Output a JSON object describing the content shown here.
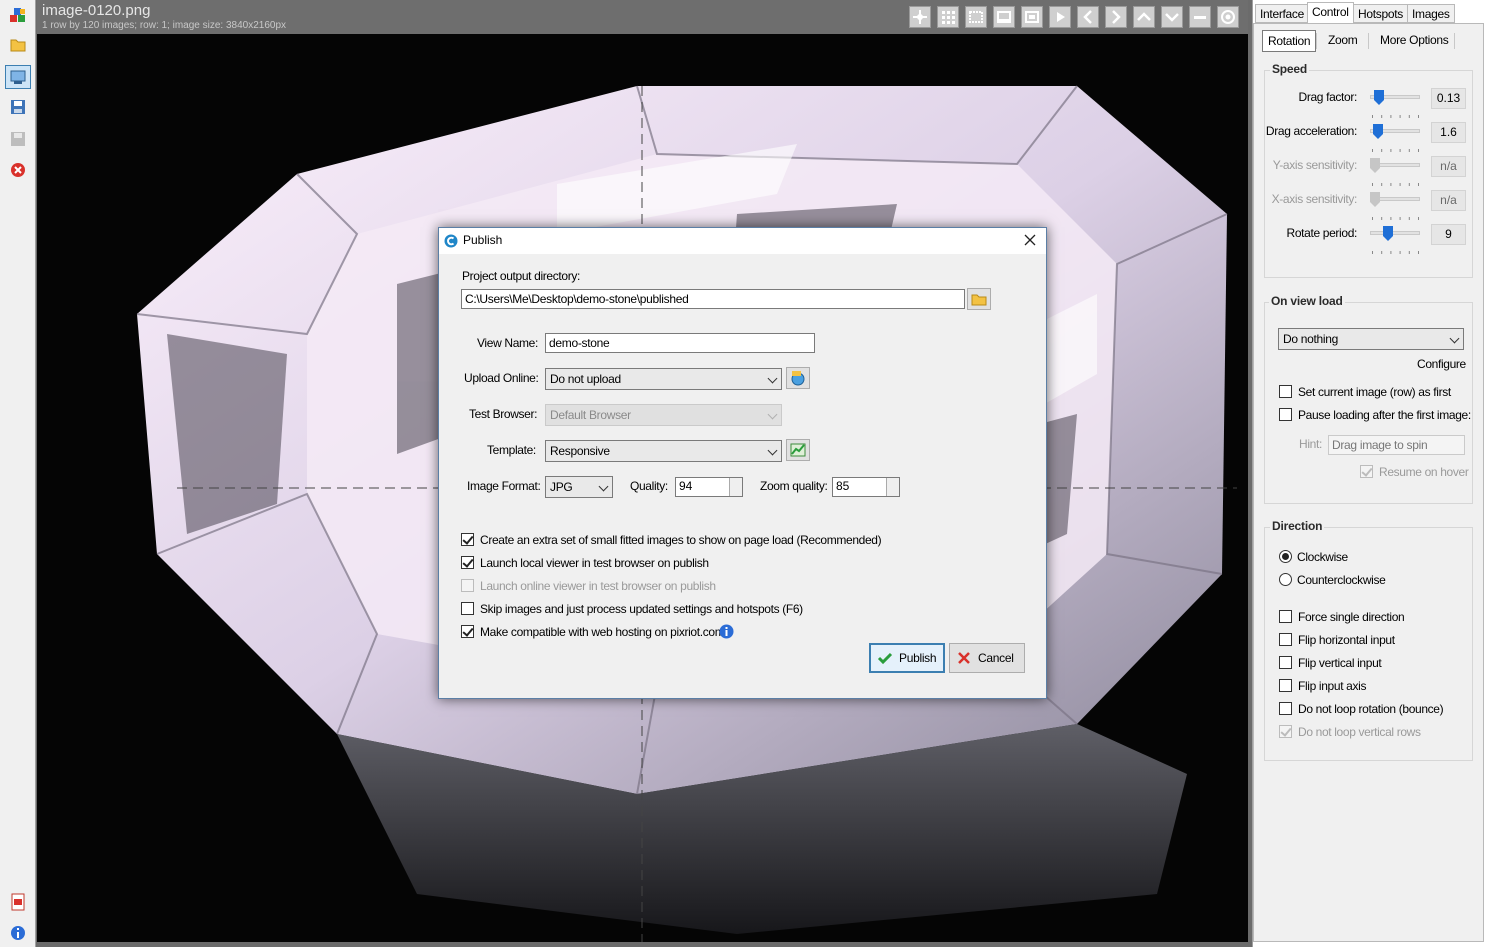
{
  "viewer": {
    "title": "image-0120.png",
    "info": "1 row by 120 images; row: 1; image size: 3840x2160px",
    "toolbar_icons": [
      "move-icon",
      "grid-icon",
      "select-icon",
      "strip-icon",
      "fit-icon",
      "play-icon",
      "prev-icon",
      "next-icon",
      "up-icon",
      "down-icon",
      "minus-icon",
      "target-icon"
    ]
  },
  "left_toolbar": {
    "icons": [
      "modules-icon",
      "open-folder-icon",
      "publish-icon",
      "save-icon",
      "disk-icon",
      "close-icon",
      "pdf-icon",
      "info-icon"
    ]
  },
  "right_panel": {
    "tabs": [
      "Interface",
      "Control",
      "Hotspots",
      "Images"
    ],
    "active_tab": "Control",
    "subtabs": [
      "Rotation",
      "Zoom",
      "More Options"
    ],
    "speed": {
      "title": "Speed",
      "rows": [
        {
          "label": "Drag factor:",
          "value": "0.13",
          "level": 0.1,
          "enabled": true
        },
        {
          "label": "Drag acceleration:",
          "value": "1.6",
          "level": 0.08,
          "enabled": true
        },
        {
          "label": "Y-axis sensitivity:",
          "value": "n/a",
          "level": 0.0,
          "enabled": false
        },
        {
          "label": "X-axis sensitivity:",
          "value": "n/a",
          "level": 0.0,
          "enabled": false
        },
        {
          "label": "Rotate period:",
          "value": "9",
          "level": 0.33,
          "enabled": true
        }
      ]
    },
    "on_view_load": {
      "title": "On view load",
      "action": "Do nothing",
      "configure": "Configure",
      "set_first": "Set current image (row) as first",
      "pause_loading": "Pause loading after the first image:",
      "hint_label": "Hint:",
      "hint_value": "Drag image to spin",
      "resume_hover": "Resume on hover"
    },
    "direction": {
      "title": "Direction",
      "clockwise": "Clockwise",
      "counterclockwise": "Counterclockwise",
      "force_single": "Force single direction",
      "flip_h": "Flip horizontal input",
      "flip_v": "Flip vertical input",
      "flip_axis": "Flip input axis",
      "no_loop": "Do not loop rotation (bounce)",
      "no_loop_v": "Do not loop vertical rows"
    }
  },
  "dialog": {
    "title": "Publish",
    "output_dir_label": "Project output directory:",
    "output_dir": "C:\\Users\\Me\\Desktop\\demo-stone\\published",
    "view_name_label": "View Name:",
    "view_name": "demo-stone",
    "upload_label": "Upload Online:",
    "upload_value": "Do not upload",
    "test_browser_label": "Test Browser:",
    "test_browser_value": "Default Browser",
    "template_label": "Template:",
    "template_value": "Responsive",
    "image_format_label": "Image Format:",
    "image_format": "JPG",
    "quality_label": "Quality:",
    "quality": "94",
    "zoom_quality_label": "Zoom quality:",
    "zoom_quality": "85",
    "opt_fitted": "Create an extra set of small fitted images to show on page load (Recommended)",
    "opt_launch_local": "Launch local viewer in test browser on publish",
    "opt_launch_online": "Launch online viewer in test browser on publish",
    "opt_skip": "Skip images and just process updated settings and hotspots (F6)",
    "opt_compat": "Make compatible with web hosting on pixriot.com",
    "publish_btn": "Publish",
    "cancel_btn": "Cancel"
  },
  "colors": {
    "accent": "#3c7fb1",
    "slider_thumb": "#1f6fd6",
    "stone_light": "#f3e6f5"
  }
}
